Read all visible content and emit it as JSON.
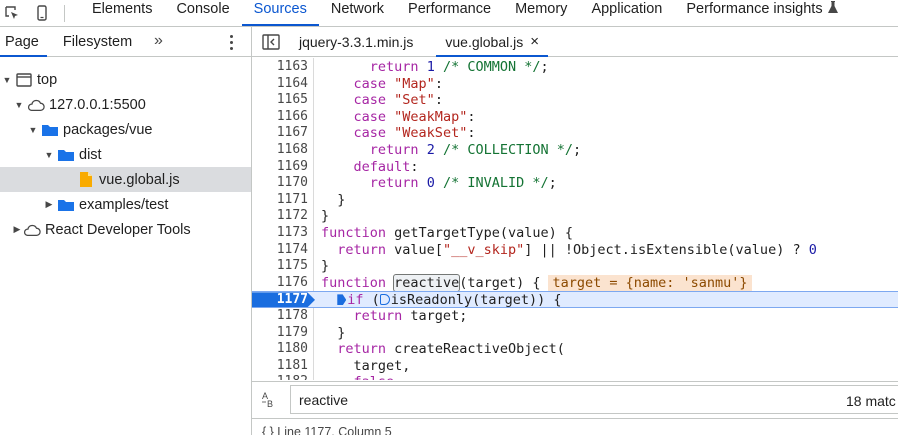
{
  "toolbar": {
    "tabs": [
      {
        "label": "Elements"
      },
      {
        "label": "Console"
      },
      {
        "label": "Sources"
      },
      {
        "label": "Network"
      },
      {
        "label": "Performance"
      },
      {
        "label": "Memory"
      },
      {
        "label": "Application"
      },
      {
        "label": "Performance insights"
      }
    ],
    "active_tab": "Sources",
    "accent_color": "#0b57d0"
  },
  "navigator": {
    "tabs": [
      {
        "label": "Page"
      },
      {
        "label": "Filesystem"
      }
    ],
    "more_label": "»",
    "tree": [
      {
        "label": "top",
        "icon": "frame-icon",
        "depth": 0,
        "expanded": true
      },
      {
        "label": "127.0.0.1:5500",
        "icon": "cloud-icon",
        "depth": 1,
        "expanded": true
      },
      {
        "label": "packages/vue",
        "icon": "folder-icon",
        "depth": 2,
        "expanded": true
      },
      {
        "label": "dist",
        "icon": "folder-icon",
        "depth": 3,
        "expanded": true
      },
      {
        "label": "vue.global.js",
        "icon": "file-icon",
        "depth": 4,
        "selected": true
      },
      {
        "label": "examples/test",
        "icon": "folder-icon",
        "depth": 2,
        "expanded": false
      },
      {
        "label": "React Developer Tools",
        "icon": "cloud-icon",
        "depth": 0,
        "expanded": false
      }
    ]
  },
  "editor": {
    "tabs": [
      {
        "label": "jquery-3.3.1.min.js"
      },
      {
        "label": "vue.global.js",
        "closable": true
      }
    ],
    "close_glyph": "×",
    "paused_line": "1177",
    "lines": [
      {
        "n": "1163",
        "text": "      return 1 /* COMMON */;"
      },
      {
        "n": "1164",
        "text": "    case \"Map\":"
      },
      {
        "n": "1165",
        "text": "    case \"Set\":"
      },
      {
        "n": "1166",
        "text": "    case \"WeakMap\":"
      },
      {
        "n": "1167",
        "text": "    case \"WeakSet\":"
      },
      {
        "n": "1168",
        "text": "      return 2 /* COLLECTION */;"
      },
      {
        "n": "1169",
        "text": "    default:"
      },
      {
        "n": "1170",
        "text": "      return 0 /* INVALID */;"
      },
      {
        "n": "1171",
        "text": "  }"
      },
      {
        "n": "1172",
        "text": "}"
      },
      {
        "n": "1173",
        "text": "function getTargetType(value) {"
      },
      {
        "n": "1174",
        "text": "  return value[\"__v_skip\"] || !Object.isExtensible(value) ? 0"
      },
      {
        "n": "1175",
        "text": "}"
      },
      {
        "n": "1176",
        "text": "function reactive(target) {"
      },
      {
        "n": "1177",
        "text": "  if (isReadonly(target)) {"
      },
      {
        "n": "1178",
        "text": "    return target;"
      },
      {
        "n": "1179",
        "text": "  }"
      },
      {
        "n": "1180",
        "text": "  return createReactiveObject("
      },
      {
        "n": "1181",
        "text": "    target,"
      },
      {
        "n": "1182",
        "text": "    false,"
      }
    ],
    "inline_value": "target = {name: 'sanmu'}"
  },
  "search": {
    "case_icon_label": "A\nB",
    "value": "reactive",
    "match_count": "18 matc"
  },
  "status": {
    "text": "{ }   Line 1177, Column 5"
  }
}
